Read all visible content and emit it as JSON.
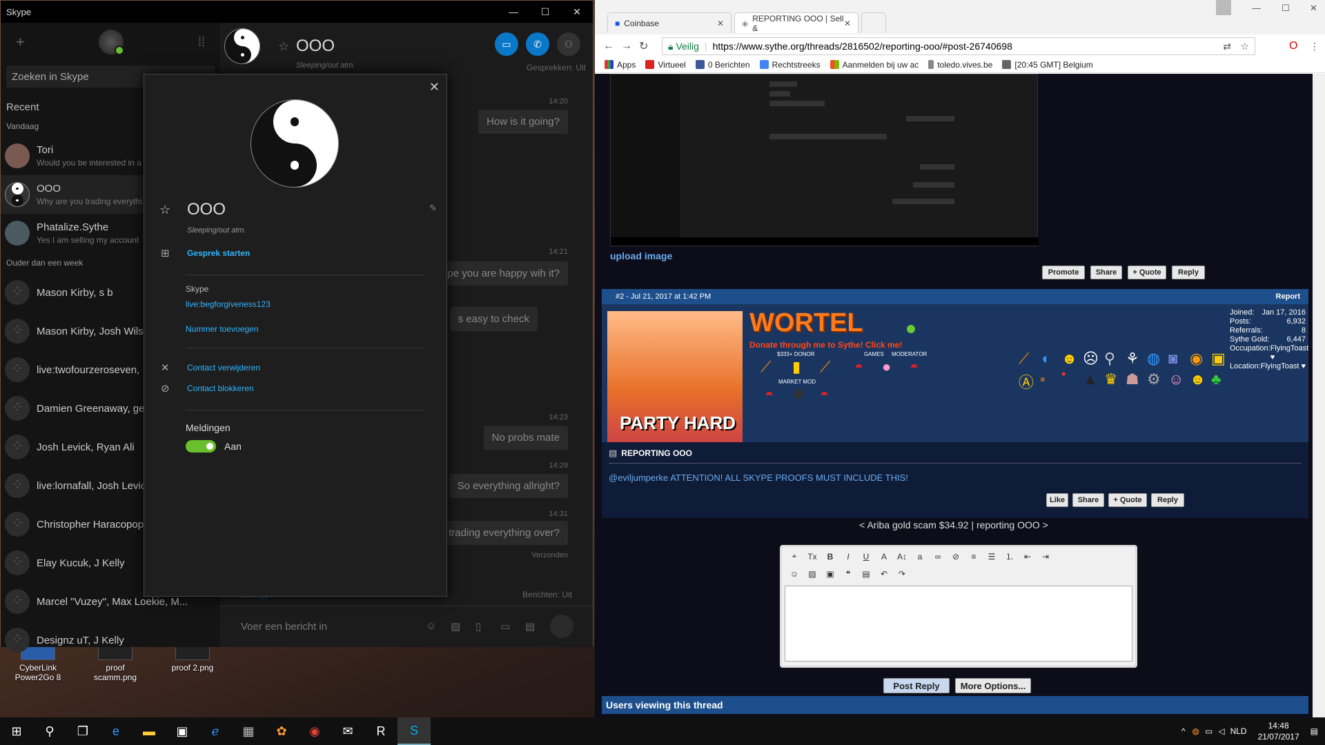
{
  "desktop": {
    "icons": [
      {
        "label": "CyberLink\nPower2Go 8"
      },
      {
        "label": "proof scamm.png"
      },
      {
        "label": "proof 2.png"
      }
    ]
  },
  "skype": {
    "title": "Skype",
    "search_placeholder": "Zoeken in Skype",
    "recent_label": "Recent",
    "today_label": "Vandaag",
    "older_label": "Ouder dan een week",
    "contacts_today": [
      {
        "name": "Tori",
        "msg": "Would you be interested in a"
      },
      {
        "name": "OOO",
        "msg": "Why are you trading everythi"
      },
      {
        "name": "Phatalize.Sythe",
        "msg": "Yes I am selling my account"
      }
    ],
    "contacts_older": [
      {
        "name": "Mason Kirby, s b"
      },
      {
        "name": "Mason Kirby, Josh Wils"
      },
      {
        "name": "live:twofourzeroseven, "
      },
      {
        "name": "Damien Greenaway, ge"
      },
      {
        "name": "Josh Levick, Ryan Ali"
      },
      {
        "name": "live:lornafall, Josh Levic"
      },
      {
        "name": "Christopher Haracopop"
      },
      {
        "name": "Elay Kucuk, J Kelly"
      },
      {
        "name": "Marcel \"Vuzey\", Max Loekie, M..."
      },
      {
        "name": "Designz uT, J Kelly"
      }
    ],
    "chat": {
      "name": "OOO",
      "status": "Sleeping/out atm.",
      "gesprekken": "Gesprekken: Uit",
      "messages": [
        {
          "time": "14:20",
          "text": "How is it going?"
        },
        {
          "time": "14:21",
          "text": "ope you are happy wih it?"
        },
        {
          "time": "",
          "text": "s easy to check"
        },
        {
          "time": "14:23",
          "text": "No probs mate"
        },
        {
          "time": "14:29",
          "text": "So everything allright?"
        },
        {
          "time": "14:31",
          "text": "u trading everything over?"
        }
      ],
      "sent_label": "Verzonden",
      "via_label": "via",
      "via_value": "Skype",
      "berichten": "Berichten: Uit",
      "compose_placeholder": "Voer een bericht in"
    },
    "profile": {
      "name": "OOO",
      "status": "Sleeping/out atm.",
      "start_chat": "Gesprek starten",
      "skype_label": "Skype",
      "skype_id": "live:begforgiveness123",
      "add_number": "Nummer toevoegen",
      "remove_contact": "Contact verwijderen",
      "block_contact": "Contact blokkeren",
      "notifications_label": "Meldingen",
      "notifications_value": "Aan"
    }
  },
  "chrome": {
    "tabs": [
      {
        "label": "Coinbase"
      },
      {
        "label": "REPORTING OOO | Sell &"
      }
    ],
    "secure_label": "Veilig",
    "url": "https://www.sythe.org/threads/2816502/reporting-ooo/#post-26740698",
    "bookmarks": [
      {
        "label": "Apps",
        "color": "#555"
      },
      {
        "label": "Virtueel",
        "color": "#d22"
      },
      {
        "label": "0 Berichten",
        "color": "#3b5998"
      },
      {
        "label": "Rechtstreeks",
        "color": "#4285f4"
      },
      {
        "label": "Aanmelden bij uw ac",
        "color": "#f25022"
      },
      {
        "label": "toledo.vives.be",
        "color": "#888"
      },
      {
        "label": "[20:45 GMT] Belgium",
        "color": "#666"
      }
    ]
  },
  "forum": {
    "upload_label": "upload image",
    "post1_buttons": [
      "Promote",
      "Share",
      "+ Quote",
      "Reply"
    ],
    "post2_header": "#2 - Jul 21, 2017 at 1:42 PM",
    "report_label": "Report",
    "username": "WORTEL",
    "donate_text": "Donate through me to Sythe! Click me!",
    "badge_donor": "$333+ DONOR",
    "badge_games": "GAMES",
    "badge_moderator": "MODERATOR",
    "badge_market": "MARKET MOD",
    "avatar_caption": "PARTY HARD",
    "stats": [
      {
        "k": "Joined:",
        "v": "Jan 17, 2016"
      },
      {
        "k": "Posts:",
        "v": "6,932"
      },
      {
        "k": "Referrals:",
        "v": "8"
      },
      {
        "k": "Sythe Gold:",
        "v": "6,447"
      },
      {
        "k": "Occupation:",
        "v": "FlyingToast ♥"
      },
      {
        "k": "Location:",
        "v": "FlyingToast ♥"
      }
    ],
    "post_title": "REPORTING OOO",
    "post_body": "@eviljumperke ATTENTION! ALL SKYPE PROOFS MUST INCLUDE THIS!",
    "post2_buttons": [
      "Like",
      "Share",
      "+ Quote",
      "Reply"
    ],
    "thread_nav": "< Ariba gold scam $34.92 | reporting OOO >",
    "post_reply": "Post Reply",
    "more_options": "More Options...",
    "users_viewing": "Users viewing this thread"
  },
  "taskbar": {
    "lang": "NLD",
    "time": "14:48",
    "date": "21/07/2017"
  }
}
